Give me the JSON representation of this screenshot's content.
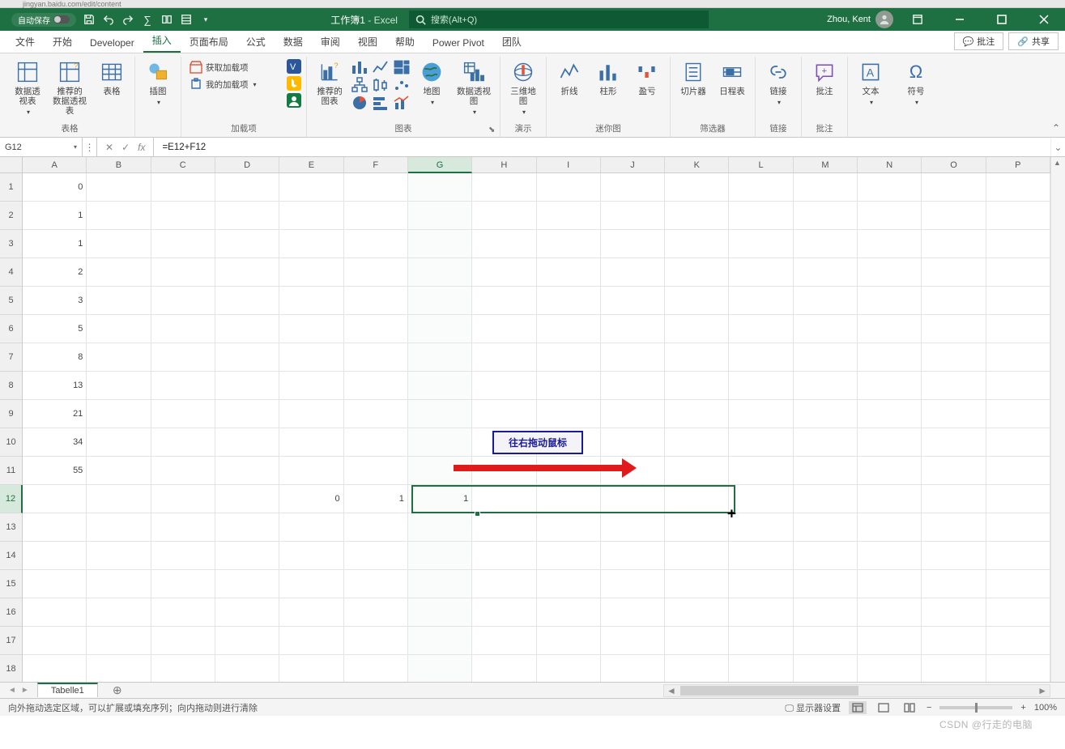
{
  "browser_remnant": "jingyan.baidu.com/edit/content",
  "titlebar": {
    "autosave_label": "自动保存",
    "doc_name": "工作簿1",
    "app_name": "Excel",
    "search_placeholder": "搜索(Alt+Q)",
    "user_name": "Zhou, Kent"
  },
  "tabs": {
    "items": [
      "文件",
      "开始",
      "Developer",
      "插入",
      "页面布局",
      "公式",
      "数据",
      "审阅",
      "视图",
      "帮助",
      "Power Pivot",
      "团队"
    ],
    "active_index": 3,
    "comments_btn": "批注",
    "share_btn": "共享"
  },
  "ribbon": {
    "groups": {
      "tables": {
        "label": "表格",
        "pivot": "数据透\n视表",
        "recommended": "推荐的\n数据透视表",
        "table": "表格"
      },
      "illustrations": {
        "label": "插图",
        "btn": "插图"
      },
      "addins": {
        "label": "加载项",
        "get": "获取加载项",
        "my": "我的加载项"
      },
      "charts": {
        "label": "图表",
        "recommended": "推荐的\n图表",
        "map": "地图",
        "pivotchart": "数据透视图"
      },
      "tours": {
        "label": "演示",
        "map3d": "三维地\n图"
      },
      "sparklines": {
        "label": "迷你图",
        "line": "折线",
        "column": "柱形",
        "winloss": "盈亏"
      },
      "filters": {
        "label": "筛选器",
        "slicer": "切片器",
        "timeline": "日程表"
      },
      "links": {
        "label": "链接",
        "link": "链接"
      },
      "comments": {
        "label": "批注",
        "comment": "批注"
      },
      "text": {
        "label": "",
        "text": "文本"
      },
      "symbols": {
        "label": "",
        "symbol": "符号"
      }
    }
  },
  "formula_bar": {
    "cell_ref": "G12",
    "formula": "=E12+F12"
  },
  "grid": {
    "columns": [
      "A",
      "B",
      "C",
      "D",
      "E",
      "F",
      "G",
      "H",
      "I",
      "J",
      "K",
      "L",
      "M",
      "N",
      "O",
      "P"
    ],
    "selected_col_index": 6,
    "rows": [
      {
        "n": "1",
        "A": "0"
      },
      {
        "n": "2",
        "A": "1"
      },
      {
        "n": "3",
        "A": "1"
      },
      {
        "n": "4",
        "A": "2"
      },
      {
        "n": "5",
        "A": "3"
      },
      {
        "n": "6",
        "A": "5"
      },
      {
        "n": "7",
        "A": "8"
      },
      {
        "n": "8",
        "A": "13"
      },
      {
        "n": "9",
        "A": "21"
      },
      {
        "n": "10",
        "A": "34"
      },
      {
        "n": "11",
        "A": "55"
      },
      {
        "n": "12",
        "E": "0",
        "F": "1",
        "G": "1"
      },
      {
        "n": "13"
      },
      {
        "n": "14"
      },
      {
        "n": "15"
      },
      {
        "n": "16"
      },
      {
        "n": "17"
      },
      {
        "n": "18"
      }
    ],
    "selected_row_index": 11
  },
  "annotation": {
    "callout_text": "往右拖动鼠标"
  },
  "sheet_tabs": {
    "active": "Tabelle1"
  },
  "status_bar": {
    "message": "向外拖动选定区域，可以扩展或填充序列；向内拖动则进行清除",
    "display_settings": "显示器设置",
    "zoom": "100%"
  },
  "watermark": "CSDN @行走的电脑"
}
